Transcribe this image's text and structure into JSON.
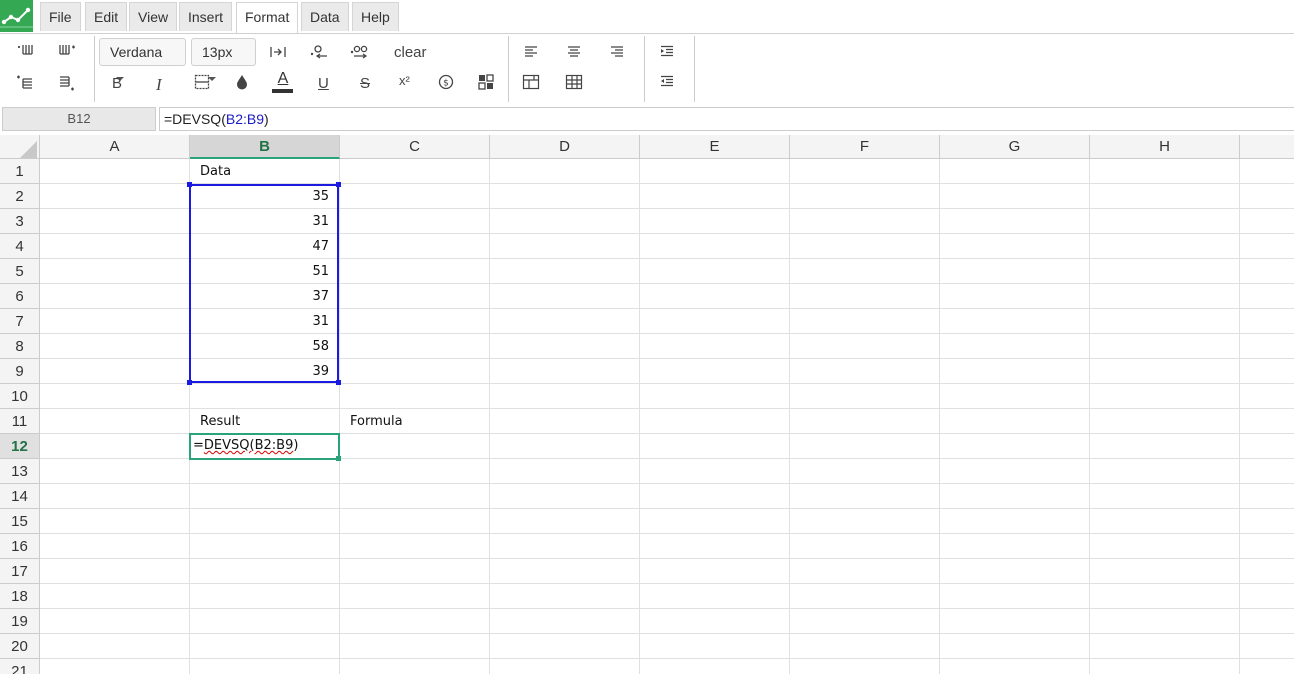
{
  "menu": {
    "items": [
      {
        "label": "File"
      },
      {
        "label": "Edit"
      },
      {
        "label": "View"
      },
      {
        "label": "Insert"
      },
      {
        "label": "Format",
        "active": true
      },
      {
        "label": "Data"
      },
      {
        "label": "Help"
      }
    ]
  },
  "toolbar": {
    "font_family": "Verdana",
    "font_size": "13px",
    "clear_label": "clear",
    "icons": [
      "insert-column-before-icon",
      "insert-column-after-icon",
      "insert-row-above-icon",
      "insert-row-below-icon",
      "bold-icon",
      "italic-icon",
      "borders-icon",
      "fill-color-icon",
      "text-color-icon",
      "underline-icon",
      "strikethrough-icon",
      "superscript-icon",
      "currency-icon",
      "conditional-format-icon",
      "wrap-text-icon",
      "decrease-decimal-icon",
      "increase-decimal-icon",
      "align-left-icon",
      "align-center-icon",
      "align-right-icon",
      "merge-cells-icon",
      "table-icon",
      "indent-icon",
      "outdent-icon"
    ],
    "bold_glyph": "B",
    "italic_glyph": "I",
    "underline_glyph": "U",
    "strike_glyph": "S",
    "text_color_glyph": "A",
    "superscript_glyph": "x²",
    "text_color_accent": "#333333"
  },
  "formula_bar": {
    "name_box": "B12",
    "formula_prefix": "=DEVSQ(",
    "formula_ref": "B2:B9",
    "formula_suffix": ")"
  },
  "sheet": {
    "columns": [
      "A",
      "B",
      "C",
      "D",
      "E",
      "F",
      "G",
      "H"
    ],
    "selected_column": "B",
    "rows": [
      "1",
      "2",
      "3",
      "4",
      "5",
      "6",
      "7",
      "8",
      "9",
      "10",
      "11",
      "12",
      "13",
      "14",
      "15",
      "16",
      "17",
      "18",
      "19",
      "20",
      "21"
    ],
    "selected_row": "12",
    "cells": {
      "B1": "Data",
      "B2": "35",
      "B3": "31",
      "B4": "47",
      "B5": "51",
      "B6": "37",
      "B7": "31",
      "B8": "58",
      "B9": "39",
      "B11": "Result",
      "C11": "Formula"
    },
    "editing_cell": {
      "ref": "B12",
      "text_prefix": "=",
      "text_underlined": "DEVSQ(B2:B9",
      "text_suffix": ")"
    },
    "colors": {
      "range_border": "#1a1ae0",
      "active_border": "#2aa37d",
      "header_selected_text": "#217346",
      "brand": "#34a853"
    }
  }
}
